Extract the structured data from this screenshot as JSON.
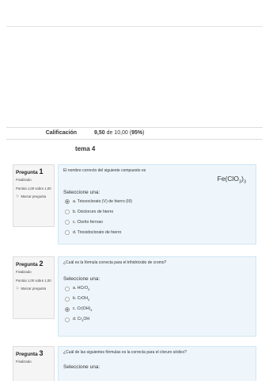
{
  "summary": {
    "label": "Calificación",
    "value_bold": "9,50",
    "value_mid": " de 10,00 (",
    "value_pct": "95%",
    "value_end": ")"
  },
  "quiz_title": "tema 4",
  "questions": [
    {
      "label": "Pregunta",
      "number": "1",
      "state": "Finalizado",
      "grade": "Puntúa 1,00 sobre 1,00",
      "flag": "Marcar pregunta",
      "text": "El nombre correcto del siguiente compuesto es",
      "formula": {
        "base": "Fe(ClO",
        "sub1": "3",
        "close": ")",
        "sub2": "3"
      },
      "prompt": "Seleccione una:",
      "options": [
        {
          "text": "a. Trioxoclorato (V) de hierro (III)",
          "checked": true
        },
        {
          "text": "b. Oxicloruro de hierro",
          "checked": false
        },
        {
          "text": "c. Clorito ferroso",
          "checked": false
        },
        {
          "text": "d. Trioxidoclorato de hierro",
          "checked": false
        }
      ]
    },
    {
      "label": "Pregunta",
      "number": "2",
      "state": "Finalizado",
      "grade": "Puntúa 1,00 sobre 1,00",
      "flag": "Marcar pregunta",
      "text": "¿Cuál es la fórmula correcta para el trihidróxido de cromo?",
      "prompt": "Seleccione una:",
      "options": [
        {
          "pre": "a. HCrO",
          "sub": "3",
          "post": "",
          "checked": false
        },
        {
          "pre": "b. CrOH",
          "sub": "3",
          "post": "",
          "checked": false
        },
        {
          "pre": "c. Cr(OH)",
          "sub": "3",
          "post": "",
          "checked": true
        },
        {
          "pre": "d. Cr",
          "sub": "3",
          "post": "OH",
          "checked": false
        }
      ]
    },
    {
      "label": "Pregunta",
      "number": "3",
      "state": "Finalizado",
      "text": "¿Cuál de las siguientes fórmulas es la correcta para el cloruro sódico?",
      "prompt": "Seleccione una:"
    }
  ]
}
